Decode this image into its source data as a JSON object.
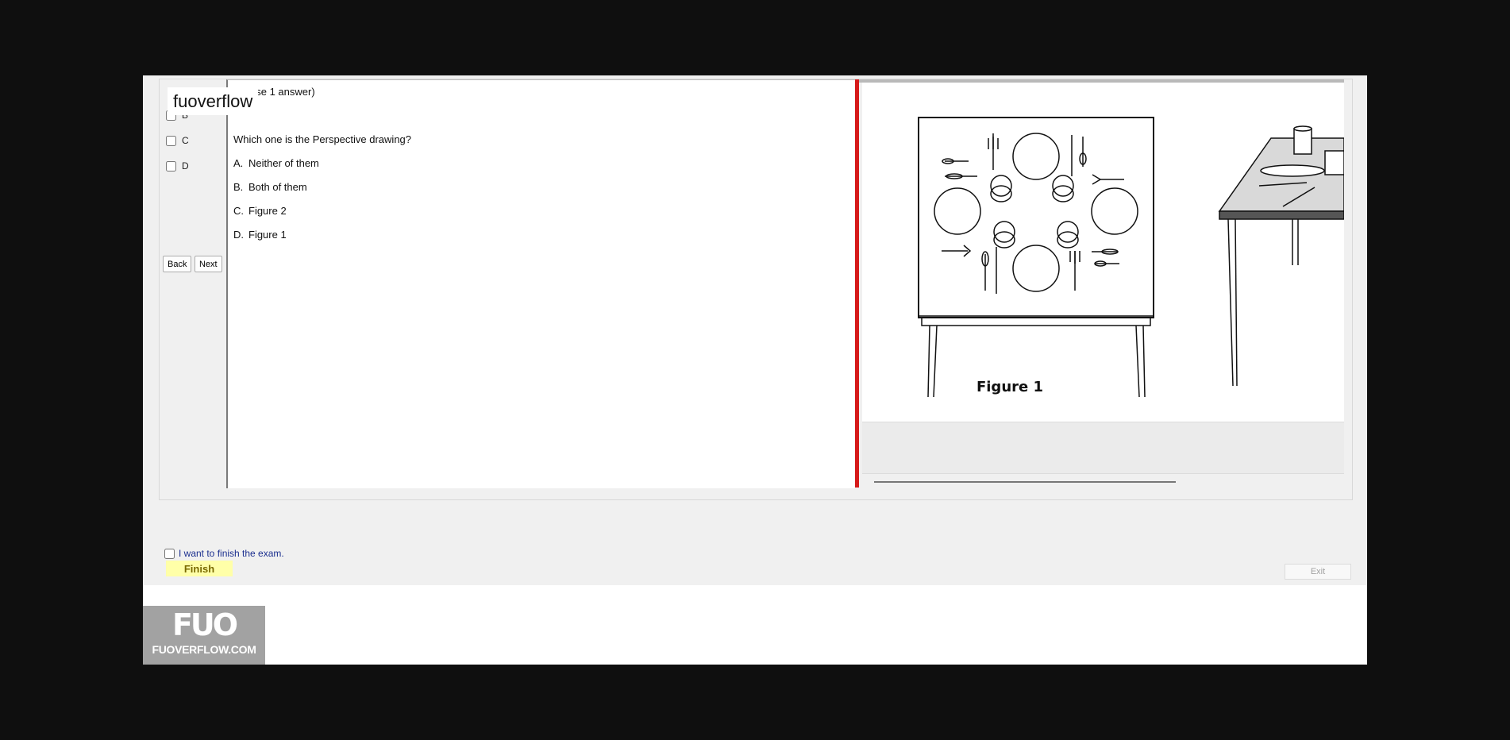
{
  "watermark": "fuoverflow",
  "answer_options": [
    "B",
    "C",
    "D"
  ],
  "nav": {
    "back_label": "Back",
    "next_label": "Next"
  },
  "question": {
    "instruction": "(Choose 1 answer)",
    "instruction_visible": "ose 1 answer)",
    "text": "Which one is the Perspective drawing?",
    "choices": [
      {
        "letter": "A.",
        "text": "Neither of them"
      },
      {
        "letter": "B.",
        "text": "Both of them"
      },
      {
        "letter": "C.",
        "text": "Figure 2"
      },
      {
        "letter": "D.",
        "text": "Figure 1"
      }
    ]
  },
  "figure": {
    "caption": "Figure 1"
  },
  "finish": {
    "checkbox_label": "I want to finish the exam.",
    "finish_label": "Finish",
    "exit_label": "Exit"
  },
  "logo": {
    "mark": "FUO",
    "site": "FUOVERFLOW.COM"
  },
  "colors": {
    "divider": "#d61a1a",
    "finish_bg": "#ffffa8",
    "link_text": "#1b2f8f",
    "frame_bg": "#0f0f0f"
  }
}
